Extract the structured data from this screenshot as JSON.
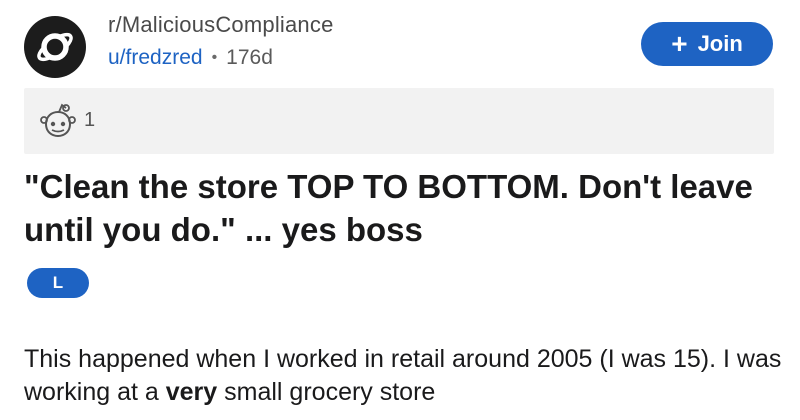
{
  "header": {
    "subreddit": "r/MaliciousCompliance",
    "username": "u/fredzred",
    "separator": "•",
    "age": "176d",
    "join_label": "Join",
    "join_plus": "+",
    "avatar_icon": "reddit-planet-logo-icon"
  },
  "awards": {
    "icon": "award-face-icon",
    "count": "1"
  },
  "post": {
    "title": "\"Clean the store TOP TO BOTTOM. Don't leave until you do.\" ... yes boss",
    "flair": "L",
    "body_part1": "This happened when I worked in retail around 2005 (I was 15). I was working at a ",
    "body_bold": "very",
    "body_part2": " small grocery store"
  },
  "colors": {
    "accent": "#1e63c3",
    "award_bar": "#f2f2f2",
    "avatar_bg": "#1c1c1c"
  }
}
